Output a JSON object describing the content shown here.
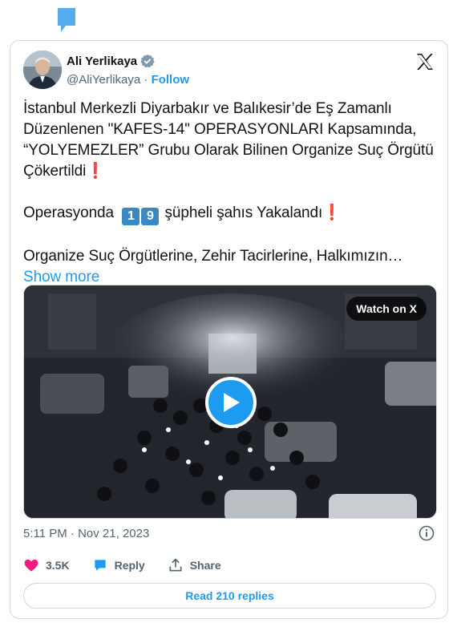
{
  "author": {
    "name": "Ali Yerlikaya",
    "handle": "@AliYerlikaya",
    "separator": "·",
    "follow_label": "Follow"
  },
  "tweet": {
    "line1": "İstanbul Merkezli Diyarbakır ve Balıkesir’de Eş Zamanlı Düzenlenen \"KAFES-14\" OPERASYONLARI Kapsamında, “YOLYEMEZLER” Grubu Olarak Bilinen Organize Suç Örgütü Çökertildi",
    "line2_prefix": "Operasyonda",
    "digit1": "1",
    "digit2": "9",
    "line2_suffix": "şüpheli şahıs Yakalandı",
    "line3": "Organize Suç Örgütlerine, Zehir Tacirlerine, Halkımızın…",
    "exclamation": "❗",
    "show_more": "Show more"
  },
  "media": {
    "watch_label": "Watch on X"
  },
  "meta": {
    "timestamp": "5:11 PM · Nov 21, 2023"
  },
  "actions": {
    "likes": "3.5K",
    "reply_label": "Reply",
    "share_label": "Share"
  },
  "read_replies_label": "Read 210 replies",
  "colors": {
    "accent": "#1d9bf0",
    "like": "#f91880",
    "text": "#0f1419",
    "muted": "#536471",
    "border": "#cfd9de"
  }
}
